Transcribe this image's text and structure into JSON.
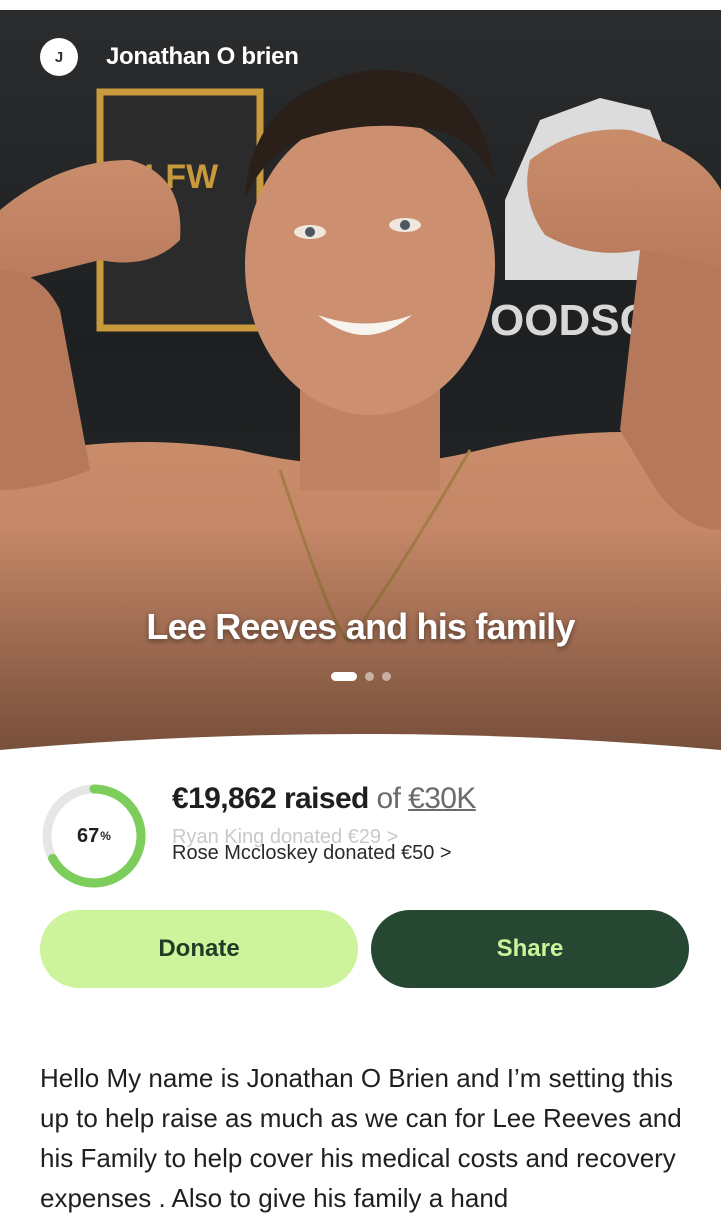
{
  "fundraiser": {
    "owner_initial": "J",
    "owner_name": "Jonathan O brien",
    "title": "Lee Reeves and his family",
    "carousel": {
      "count": 3,
      "active": 0
    },
    "hero_backdrop_text": {
      "brand_left": "ALFW",
      "brand_right": "OODSCH"
    }
  },
  "stats": {
    "percent": 67,
    "percent_label": "67",
    "percent_sign": "%",
    "raised_amount": "€19,862 raised",
    "raised_of": "of",
    "goal": "€30K",
    "recent_donation_ghost": "Ryan King donated €29 >",
    "recent_donation": "Rose Mccloskey donated €50 >"
  },
  "actions": {
    "donate_label": "Donate",
    "share_label": "Share"
  },
  "story": {
    "text": "Hello My name is Jonathan O Brien and I’m setting this up to help raise as much as we can for Lee Reeves and his Family to help cover his medical costs and recovery expenses . Also to give his family a hand"
  },
  "colors": {
    "accent_light": "#cdf39c",
    "accent_dark": "#264832",
    "progress_track": "#e6e6e6",
    "progress_fill": "#7ccd5a"
  }
}
